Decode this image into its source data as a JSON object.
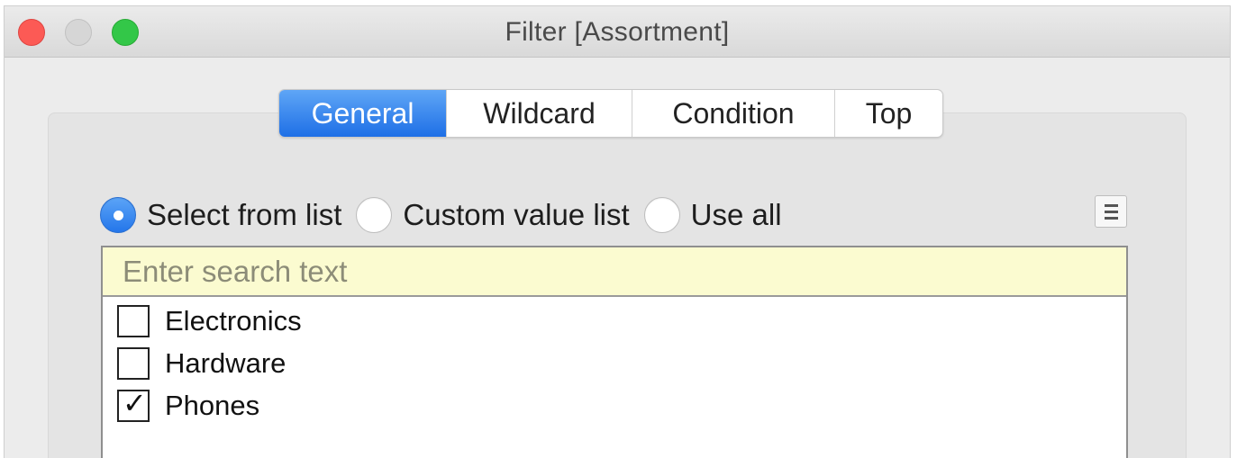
{
  "window": {
    "title": "Filter [Assortment]"
  },
  "tabs": [
    {
      "label": "General",
      "active": true
    },
    {
      "label": "Wildcard",
      "active": false
    },
    {
      "label": "Condition",
      "active": false
    },
    {
      "label": "Top",
      "active": false
    }
  ],
  "radio_options": [
    {
      "label": "Select from list",
      "selected": true
    },
    {
      "label": "Custom value list",
      "selected": false
    },
    {
      "label": "Use all",
      "selected": false
    }
  ],
  "search": {
    "placeholder": "Enter search text",
    "value": ""
  },
  "list_items": [
    {
      "label": "Electronics",
      "checked": false
    },
    {
      "label": "Hardware",
      "checked": false
    },
    {
      "label": "Phones",
      "checked": true
    }
  ],
  "icons": {
    "checkmark": "✓",
    "menu": "hamburger-menu-icon"
  },
  "colors": {
    "accent": "#2476ea",
    "search_background": "#fbfbd0",
    "close": "#fc5a55",
    "zoom": "#33c748"
  }
}
